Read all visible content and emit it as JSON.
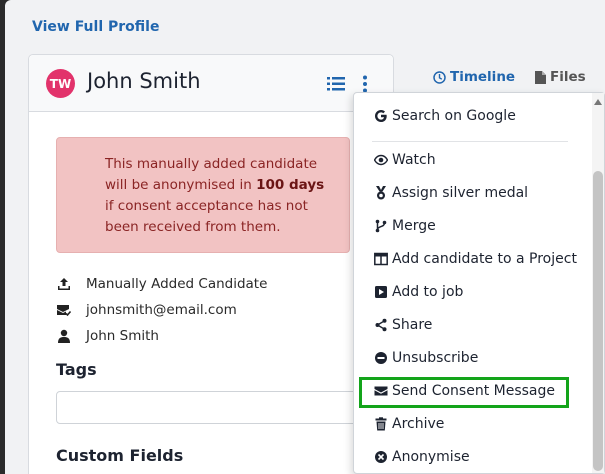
{
  "header": {
    "view_profile": "View Full Profile"
  },
  "candidate": {
    "initials": "TW",
    "name": "John Smith",
    "alert": {
      "line1": "This manually added candidate",
      "line2_pre": "will be anonymised in ",
      "line2_bold": "100 days",
      "line3": "if consent acceptance has not",
      "line4": "been received from them."
    },
    "info": {
      "source": "Manually Added Candidate",
      "email": "johnsmith@email.com",
      "person": "John Smith"
    },
    "tags_title": "Tags",
    "custom_fields_title": "Custom Fields"
  },
  "tabs": {
    "timeline": "Timeline",
    "files": "Files"
  },
  "menu": {
    "items": [
      {
        "label": "Search on Google",
        "icon": "google-icon"
      },
      {
        "label": "Watch",
        "icon": "eye-icon"
      },
      {
        "label": "Assign silver medal",
        "icon": "medal-icon"
      },
      {
        "label": "Merge",
        "icon": "merge-icon"
      },
      {
        "label": "Add candidate to a Project",
        "icon": "project-icon"
      },
      {
        "label": "Add to job",
        "icon": "play-square-icon"
      },
      {
        "label": "Share",
        "icon": "share-icon"
      },
      {
        "label": "Unsubscribe",
        "icon": "minus-circle-icon"
      },
      {
        "label": "Send Consent Message",
        "icon": "envelope-icon"
      },
      {
        "label": "Archive",
        "icon": "trash-icon"
      },
      {
        "label": "Anonymise",
        "icon": "times-circle-icon"
      }
    ]
  },
  "colors": {
    "accent": "#2166ae",
    "avatar": "#e2336b",
    "highlight": "#13a41a",
    "alert_bg": "#f2c3c3"
  }
}
